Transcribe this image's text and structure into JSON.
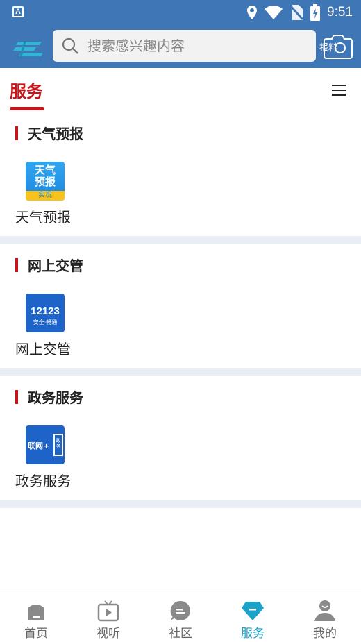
{
  "status_bar": {
    "time": "9:51",
    "notification_letter": "A"
  },
  "header": {
    "search_placeholder": "搜索感兴趣内容",
    "report_label": "报料"
  },
  "tabs": {
    "active_label": "服务"
  },
  "sections": [
    {
      "title": "天气预报",
      "app_label": "天气预报",
      "icon_lines": [
        "天气",
        "预报"
      ],
      "icon_sub": "实况"
    },
    {
      "title": "网上交管",
      "app_label": "网上交管",
      "icon_lines": [
        "12123"
      ],
      "icon_sub": "安全·畅通"
    },
    {
      "title": "政务服务",
      "app_label": "政务服务",
      "icon_lines": [
        "联网+",
        "政务"
      ],
      "icon_sub": ""
    }
  ],
  "bottom_nav": [
    {
      "label": "首页",
      "icon": "home-icon",
      "active": false
    },
    {
      "label": "视听",
      "icon": "tv-icon",
      "active": false
    },
    {
      "label": "社区",
      "icon": "chat-icon",
      "active": false
    },
    {
      "label": "服务",
      "icon": "diamond-icon",
      "active": true
    },
    {
      "label": "我的",
      "icon": "user-icon",
      "active": false
    }
  ],
  "colors": {
    "brand_blue": "#3f76b6",
    "accent_red": "#c8151b",
    "active_cyan": "#1aa2c9"
  }
}
